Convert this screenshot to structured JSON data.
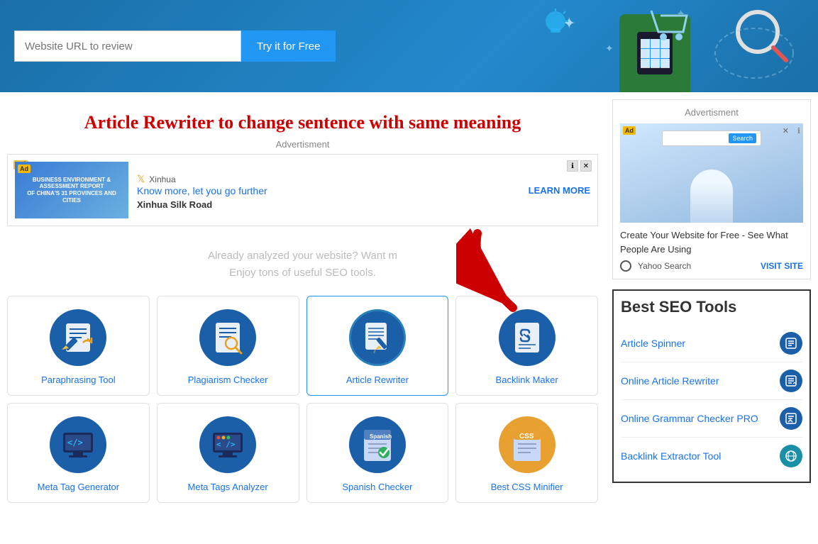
{
  "header": {
    "url_placeholder": "Website URL to review",
    "try_btn_label": "Try it for Free"
  },
  "page": {
    "title": "Article Rewriter to change sentence with same meaning",
    "ad_label": "Advertisment",
    "analyzed_text_line1": "Already analyzed your website? Want m",
    "analyzed_text_line2": "Enjoy tons of useful SEO tools."
  },
  "ad_banner": {
    "ad_badge": "Ad",
    "title": "Know more, let you go further",
    "subtitle": "Xinhua Silk Road",
    "learn_more": "LEARN MORE",
    "logo": "Xinhua"
  },
  "tools": [
    {
      "id": "paraphrasing",
      "label": "Paraphrasing Tool",
      "color": "#1a5fa8",
      "icon_type": "paraphrase"
    },
    {
      "id": "plagiarism",
      "label": "Plagiarism Checker",
      "color": "#1a5fa8",
      "icon_type": "plagiarism"
    },
    {
      "id": "article-rewriter",
      "label": "Article Rewriter",
      "color": "#1a5fa8",
      "icon_type": "rewriter"
    },
    {
      "id": "backlink-maker",
      "label": "Backlink Maker",
      "color": "#1a5fa8",
      "icon_type": "backlink"
    },
    {
      "id": "meta-tag",
      "label": "Meta Tag Generator",
      "color": "#1a5fa8",
      "icon_type": "metatag"
    },
    {
      "id": "meta-tags-analyzer",
      "label": "Meta Tags Analyzer",
      "color": "#1a5fa8",
      "icon_type": "analyzer"
    },
    {
      "id": "spanish-checker",
      "label": "Spanish Checker",
      "color": "#1a5fa8",
      "icon_type": "spanish"
    },
    {
      "id": "css-minifier",
      "label": "Best CSS Minifier",
      "color": "#e8a030",
      "icon_type": "css"
    }
  ],
  "sidebar": {
    "ad_label": "Advertisment",
    "ad_body": "Create Your Website for Free - See What People Are Using",
    "ad_source": "Yahoo Search",
    "ad_visit": "VISIT SITE",
    "seo_title": "Best SEO Tools",
    "seo_tools": [
      {
        "label": "Article Spinner",
        "icon": "📄",
        "icon_color": "blue"
      },
      {
        "label": "Online Article Rewriter",
        "icon": "📝",
        "icon_color": "blue"
      },
      {
        "label": "Online Grammar Checker PRO",
        "icon": "📋",
        "icon_color": "blue"
      },
      {
        "label": "Backlink Extractor Tool",
        "icon": "🔗",
        "icon_color": "teal"
      }
    ]
  }
}
